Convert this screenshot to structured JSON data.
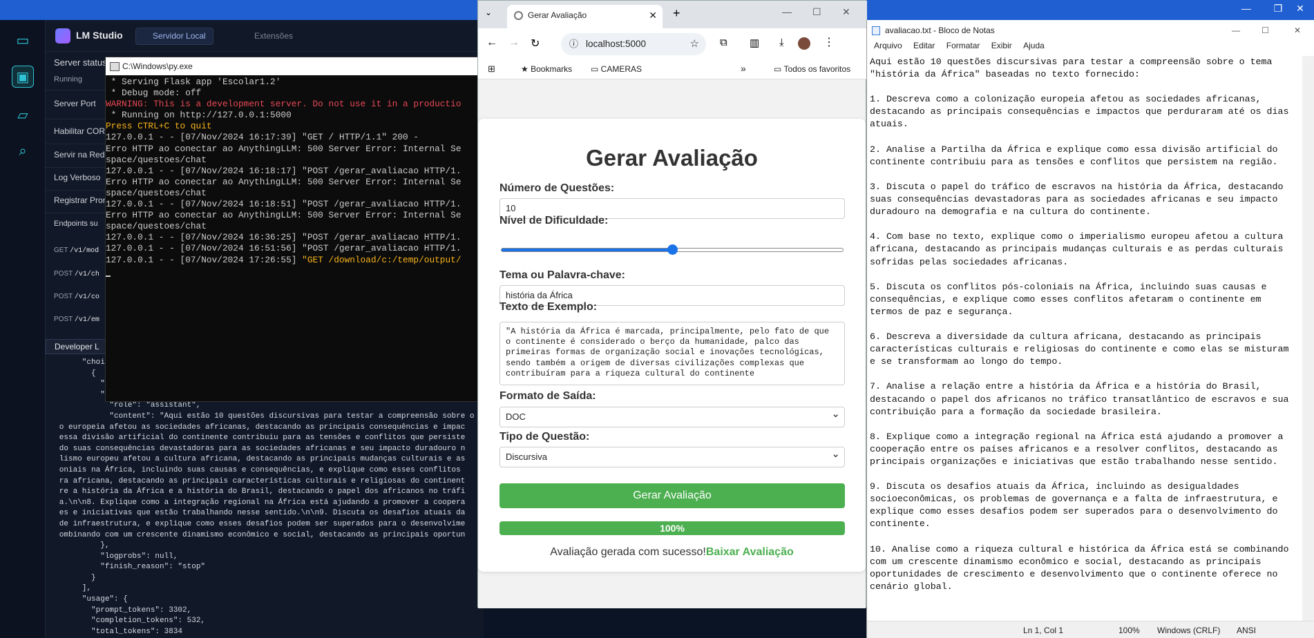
{
  "lmstudio": {
    "title": "LM Studio",
    "tabs": [
      "Servidor Local",
      "Extensões"
    ],
    "server_status_label": "Server status",
    "server_status_value": "Running",
    "settings": [
      "Server Port",
      "Habilitar CORS",
      "Servir na Rede",
      "Log Verboso",
      "Registrar Prom"
    ],
    "endpoints_label": "Endpoints su",
    "endpoints": [
      {
        "method": "GET",
        "path": "/v1/mod"
      },
      {
        "method": "POST",
        "path": "/v1/ch"
      },
      {
        "method": "POST",
        "path": "/v1/co"
      },
      {
        "method": "POST",
        "path": "/v1/em"
      }
    ],
    "dev_logs_label": "Developer L",
    "json_log": "        \"choic\n          {\n            \"i\n            \"m\n              \"role\": \"assistant\",\n              \"content\": \"Aqui estão 10 questões discursivas para testar a compreensão sobre o\n   o europeia afetou as sociedades africanas, destacando as principais consequências e impac\n   essa divisão artificial do continente contribuiu para as tensões e conflitos que persiste\n   do suas consequências devastadoras para as sociedades africanas e seu impacto duradouro n\n   lismo europeu afetou a cultura africana, destacando as principais mudanças culturais e as\n   oniais na África, incluindo suas causas e consequências, e explique como esses conflitos\n   ra africana, destacando as principais características culturais e religiosas do continent\n   re a história da África e a história do Brasil, destacando o papel dos africanos no tráfi\n   a.\\n\\n8. Explique como a integração regional na África está ajudando a promover a coopera\n   es e iniciativas que estão trabalhando nesse sentido.\\n\\n9. Discuta os desafios atuais da\n   de infraestrutura, e explique como esses desafios podem ser superados para o desenvolvime\n   ombinando com um crescente dinamismo econômico e social, destacando as principais oportun\n            },\n            \"logprobs\": null,\n            \"finish_reason\": \"stop\"\n          }\n        ],\n        \"usage\": {\n          \"prompt_tokens\": 3302,\n          \"completion_tokens\": 532,\n          \"total_tokens\": 3834"
  },
  "cmd": {
    "title": "C:\\Windows\\py.exe",
    "lines": [
      {
        "t": " * Serving Flask app 'Escolar1.2'",
        "c": ""
      },
      {
        "t": " * Debug mode: off",
        "c": ""
      },
      {
        "t": "WARNING: This is a development server. Do not use it in a productio",
        "c": "red"
      },
      {
        "t": " * Running on http://127.0.0.1:5000",
        "c": ""
      },
      {
        "t": "Press CTRL+C to quit",
        "c": "yel"
      },
      {
        "t": "127.0.0.1 - - [07/Nov/2024 16:17:39] \"GET / HTTP/1.1\" 200 -",
        "c": ""
      },
      {
        "t": "Erro HTTP ao conectar ao AnythingLLM: 500 Server Error: Internal Se",
        "c": ""
      },
      {
        "t": "space/questoes/chat",
        "c": ""
      },
      {
        "t": "127.0.0.1 - - [07/Nov/2024 16:18:17] \"POST /gerar_avaliacao HTTP/1.",
        "c": ""
      },
      {
        "t": "Erro HTTP ao conectar ao AnythingLLM: 500 Server Error: Internal Se",
        "c": ""
      },
      {
        "t": "space/questoes/chat",
        "c": ""
      },
      {
        "t": "127.0.0.1 - - [07/Nov/2024 16:18:51] \"POST /gerar_avaliacao HTTP/1.",
        "c": ""
      },
      {
        "t": "Erro HTTP ao conectar ao AnythingLLM: 500 Server Error: Internal Se",
        "c": ""
      },
      {
        "t": "space/questoes/chat",
        "c": ""
      },
      {
        "t": "127.0.0.1 - - [07/Nov/2024 16:36:25] \"POST /gerar_avaliacao HTTP/1.",
        "c": ""
      },
      {
        "t": "127.0.0.1 - - [07/Nov/2024 16:51:56] \"POST /gerar_avaliacao HTTP/1.",
        "c": ""
      }
    ],
    "last_line_prefix": "127.0.0.1 - - [07/Nov/2024 17:26:55] ",
    "last_line_yellow": "\"GET /download/c:/temp/output/"
  },
  "chrome": {
    "tab_title": "Gerar Avaliação",
    "url": "localhost:5000",
    "bookmarks": [
      "Bookmarks",
      "CAMERAS"
    ],
    "all_bookmarks": "Todos os favoritos",
    "form": {
      "heading": "Gerar Avaliação",
      "num_label": "Número de Questões:",
      "num_value": "10",
      "difficulty_label": "Nível de Dificuldade:",
      "difficulty_level": 0.5,
      "topic_label": "Tema ou Palavra-chave:",
      "topic_value": "história da África",
      "example_label": "Texto de Exemplo:",
      "example_value": "\"A história da África é marcada, principalmente, pelo fato de que o continente é considerado o berço da humanidade, palco das primeiras formas de organização social e inovações tecnológicas, sendo também a origem de diversas civilizações complexas que contribuíram para a riqueza cultural do continente",
      "format_label": "Formato de Saída:",
      "format_value": "DOC",
      "type_label": "Tipo de Questão:",
      "type_value": "Discursiva",
      "submit": "Gerar Avaliação",
      "progress": "100%",
      "success": "Avaliação gerada com sucesso!",
      "download": "Baixar Avaliação"
    }
  },
  "notepad": {
    "title": "avaliacao.txt - Bloco de Notas",
    "menu": [
      "Arquivo",
      "Editar",
      "Formatar",
      "Exibir",
      "Ajuda"
    ],
    "content": "Aqui estão 10 questões discursivas para testar a compreensão sobre o tema\n\"história da África\" baseadas no texto fornecido:\n\n1. Descreva como a colonização europeia afetou as sociedades africanas,\ndestacando as principais consequências e impactos que perduraram até os dias\natuais.\n\n2. Analise a Partilha da África e explique como essa divisão artificial do\ncontinente contribuiu para as tensões e conflitos que persistem na região.\n\n3. Discuta o papel do tráfico de escravos na história da África, destacando\nsuas consequências devastadoras para as sociedades africanas e seu impacto\nduradouro na demografia e na cultura do continente.\n\n4. Com base no texto, explique como o imperialismo europeu afetou a cultura\nafricana, destacando as principais mudanças culturais e as perdas culturais\nsofridas pelas sociedades africanas.\n\n5. Discuta os conflitos pós-coloniais na África, incluindo suas causas e\nconsequências, e explique como esses conflitos afetaram o continente em\ntermos de paz e segurança.\n\n6. Descreva a diversidade da cultura africana, destacando as principais\ncaracterísticas culturais e religiosas do continente e como elas se misturam\ne se transformam ao longo do tempo.\n\n7. Analise a relação entre a história da África e a história do Brasil,\ndestacando o papel dos africanos no tráfico transatlântico de escravos e sua\ncontribuição para a formação da sociedade brasileira.\n\n8. Explique como a integração regional na África está ajudando a promover a\ncooperação entre os países africanos e a resolver conflitos, destacando as\nprincipais organizações e iniciativas que estão trabalhando nesse sentido.\n\n9. Discuta os desafios atuais da África, incluindo as desigualdades\nsocioeconômicas, os problemas de governança e a falta de infraestrutura, e\nexplique como esses desafios podem ser superados para o desenvolvimento do\ncontinente.\n\n10. Analise como a riqueza cultural e histórica da África está se combinando\ncom um crescente dinamismo econômico e social, destacando as principais\noportunidades de crescimento e desenvolvimento que o continente oferece no\ncenário global.",
    "status": {
      "position": "Ln 1, Col 1",
      "zoom": "100%",
      "eol": "Windows (CRLF)",
      "encoding": "ANSI"
    }
  }
}
